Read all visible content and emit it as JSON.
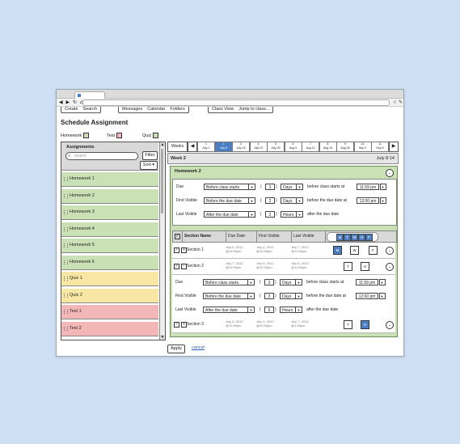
{
  "menu": {
    "group1": [
      "Create",
      "Search"
    ],
    "group2": [
      "Messages",
      "Calendar",
      "Folders"
    ],
    "group3": [
      "Class View",
      "Jump to class..."
    ]
  },
  "page_title": "Schedule Assignment",
  "types": [
    "Homework",
    "Test",
    "Quiz"
  ],
  "assignments": {
    "title": "Assignments",
    "search_placeholder": "search",
    "filter_label": "Filter",
    "sort_label": "Sort",
    "items": [
      {
        "label": "Homework 1",
        "color": "#c9e1b4"
      },
      {
        "label": "Homework 2",
        "color": "#c9e1b4"
      },
      {
        "label": "Homework 3",
        "color": "#c9e1b4"
      },
      {
        "label": "Homework 4",
        "color": "#c9e1b4"
      },
      {
        "label": "Homework 5",
        "color": "#c9e1b4"
      },
      {
        "label": "Homework 6",
        "color": "#c9e1b4"
      },
      {
        "label": "Quiz 1",
        "color": "#f7e6a4"
      },
      {
        "label": "Quiz 2",
        "color": "#f7e6a4"
      },
      {
        "label": "Test 1",
        "color": "#f3b7b7"
      },
      {
        "label": "Test 2",
        "color": "#f3b7b7"
      }
    ]
  },
  "weeks": {
    "label": "Weeks",
    "list": [
      {
        "n": "1",
        "d": "July 1"
      },
      {
        "n": "2",
        "d": "July 8"
      },
      {
        "n": "3",
        "d": "July 15"
      },
      {
        "n": "4",
        "d": "July 22"
      },
      {
        "n": "5",
        "d": "July 29"
      },
      {
        "n": "6",
        "d": "Aug 5"
      },
      {
        "n": "7",
        "d": "Aug 12"
      },
      {
        "n": "8",
        "d": "Aug 19"
      },
      {
        "n": "9",
        "d": "Aug 26"
      },
      {
        "n": "10",
        "d": "Sep 2"
      },
      {
        "n": "11",
        "d": "Sep 9"
      }
    ],
    "selected_index": 1
  },
  "week_header": {
    "title": "Week 2",
    "range": "July 8-14"
  },
  "homework": {
    "title": "Homework 2",
    "rows": [
      {
        "label": "Due",
        "select": "Before class starts",
        "num": "3",
        "unit": "Days",
        "text": "before class starts at",
        "time": "11:59 pm"
      },
      {
        "label": "First Visible",
        "select": "Before the due date",
        "num": "2",
        "unit": "Days",
        "text": "before the due date at",
        "time": "12:00 pm"
      },
      {
        "label": "Last Visible",
        "select": "After the due date",
        "num": "2",
        "unit": "Hours",
        "text": "after the due date",
        "time": ""
      }
    ],
    "table_headers": [
      "Section Name",
      "Due Date",
      "First Visible",
      "Last Visible"
    ],
    "days": [
      "M",
      "T",
      "W",
      "H",
      "F"
    ],
    "sections": [
      {
        "name": "Section 1",
        "due": [
          "July 6, 2012",
          "@11:59pm"
        ],
        "first": [
          "July 4, 2012",
          "@12:00pm"
        ],
        "last": [
          "July 7, 2012",
          "@11:59pm"
        ],
        "days": [
          "M",
          "W",
          "F"
        ]
      },
      {
        "name": "Section 2",
        "due": [
          "July 7, 2012",
          "@11:59pm"
        ],
        "first": [
          "July 5, 2012",
          "@12:00pm"
        ],
        "last": [
          "July 8, 2012",
          "@11:59pm"
        ],
        "days": [
          "T",
          "H"
        ]
      },
      {
        "name": "Section 3",
        "due": [
          "July 6, 2012",
          "@11:59pm"
        ],
        "first": [
          "July 4, 2012",
          "@12:00pm"
        ],
        "last": [
          "July 7, 2012",
          "@1:59pm"
        ],
        "days": [
          "T",
          "H"
        ]
      }
    ],
    "section2_rows": [
      {
        "label": "Due",
        "select": "Before class starts",
        "num": "3",
        "unit": "Days",
        "text": "before class starts at",
        "time": "11:59 pm"
      },
      {
        "label": "First Visible",
        "select": "Before the due date",
        "num": "2",
        "unit": "Days",
        "text": "before the due date at",
        "time": "12:00 pm"
      },
      {
        "label": "Last Visible",
        "select": "After the due date",
        "num": "6",
        "unit": "Hours",
        "text": "after the due date",
        "time": ""
      }
    ]
  },
  "footer": {
    "apply": "Apply",
    "cancel": "cancel"
  }
}
